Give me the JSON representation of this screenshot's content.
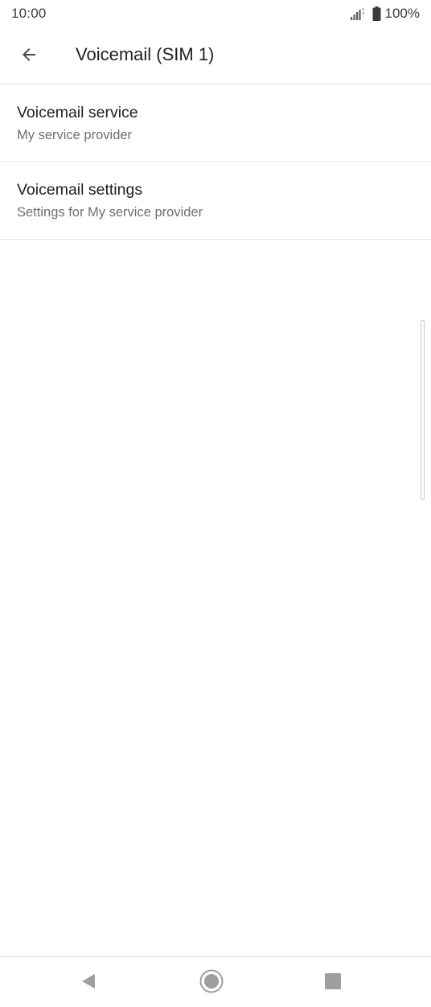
{
  "status_bar": {
    "time": "10:00",
    "battery_level": "100%",
    "signal_icon": "signal-icon",
    "battery_icon": "battery-full-icon"
  },
  "app_bar": {
    "back_icon": "arrow-back-icon",
    "title": "Voicemail (SIM 1)"
  },
  "items": [
    {
      "title": "Voicemail service",
      "subtitle": "My service provider"
    },
    {
      "title": "Voicemail settings",
      "subtitle": "Settings for My service provider"
    }
  ],
  "nav_bar": {
    "back_icon": "nav-back-triangle-icon",
    "home_icon": "nav-home-circle-icon",
    "recents_icon": "nav-recents-square-icon"
  },
  "colors": {
    "background": "#ffffff",
    "text_primary": "#202124",
    "text_secondary": "#6f6f6f",
    "divider": "#e4e4e4",
    "nav_icon": "#9e9e9e"
  }
}
